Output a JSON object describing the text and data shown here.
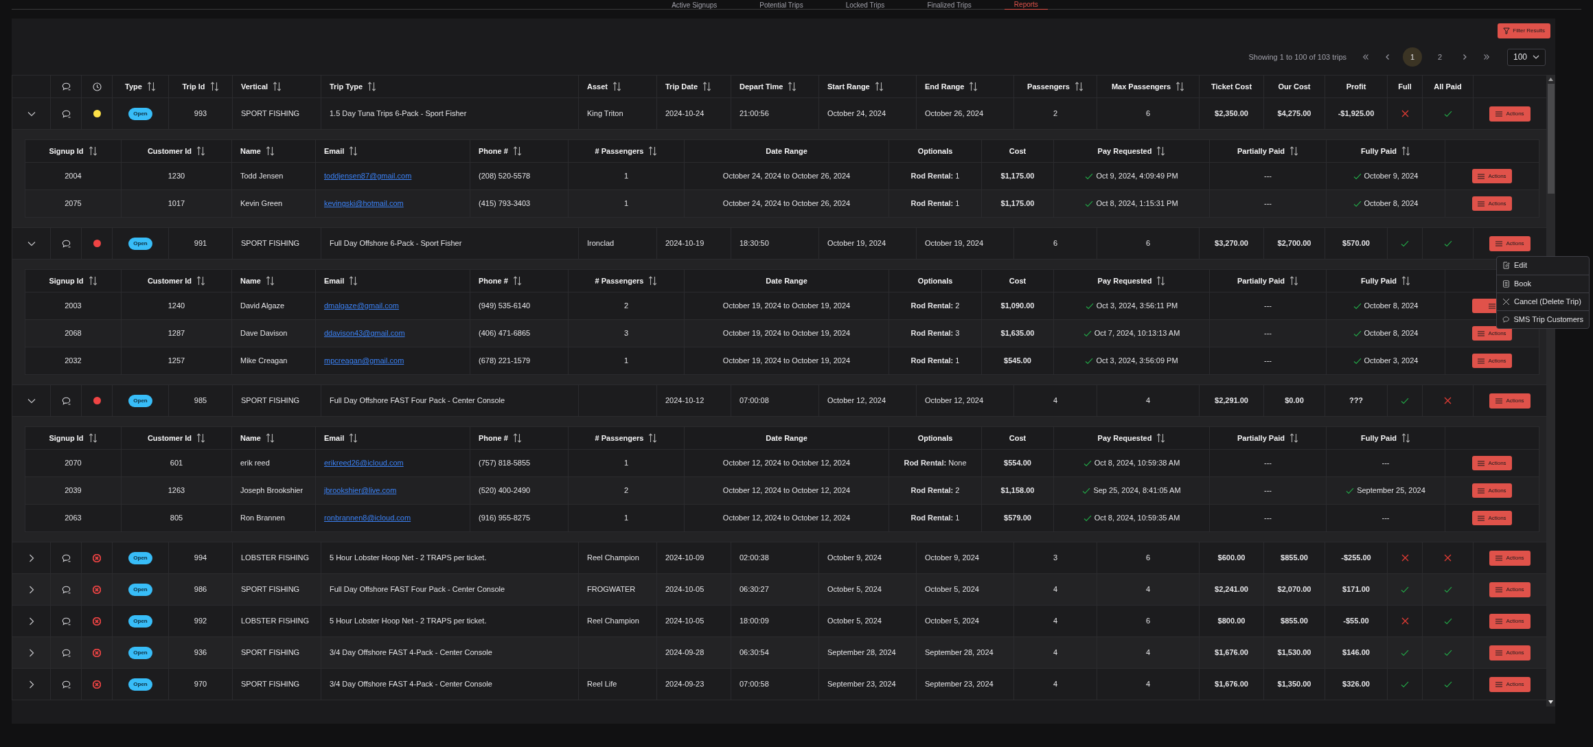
{
  "tabs": [
    {
      "label": "Active Signups",
      "selected": false
    },
    {
      "label": "Potential Trips",
      "selected": false
    },
    {
      "label": "Locked Trips",
      "selected": false
    },
    {
      "label": "Finalized Trips",
      "selected": false
    },
    {
      "label": "Reports",
      "selected": true
    }
  ],
  "filter_button": "Filter Results",
  "pagination": {
    "summary": "Showing 1 to 100 of 103 trips",
    "pages": [
      {
        "label": "1",
        "selected": true
      },
      {
        "label": "2",
        "selected": false
      }
    ],
    "page_size": "100"
  },
  "columns": [
    {
      "label": "Type",
      "sortable": true
    },
    {
      "label": "Trip Id",
      "sortable": true
    },
    {
      "label": "Vertical",
      "sortable": true
    },
    {
      "label": "Trip Type",
      "sortable": true
    },
    {
      "label": "Asset",
      "sortable": true
    },
    {
      "label": "Trip Date",
      "sortable": true
    },
    {
      "label": "Depart Time",
      "sortable": true
    },
    {
      "label": "Start Range",
      "sortable": true
    },
    {
      "label": "End Range",
      "sortable": true
    },
    {
      "label": "Passengers",
      "sortable": true
    },
    {
      "label": "Max Passengers",
      "sortable": true
    },
    {
      "label": "Ticket Cost",
      "sortable": false
    },
    {
      "label": "Our Cost",
      "sortable": false
    },
    {
      "label": "Profit",
      "sortable": false
    },
    {
      "label": "Full",
      "sortable": false
    },
    {
      "label": "All Paid",
      "sortable": false
    }
  ],
  "trips": [
    {
      "expanded": true,
      "status": {
        "kind": "dot",
        "color": "#fde047"
      },
      "type": "Open",
      "trip_id": "993",
      "vertical": "SPORT FISHING",
      "trip_type": "1.5 Day Tuna Trips 6-Pack - Sport Fisher",
      "asset": "King Triton",
      "trip_date": "2024-10-24",
      "depart_time": "21:00:56",
      "start_range": "October 24, 2024",
      "end_range": "October 26, 2024",
      "passengers": "2",
      "max_passengers": "6",
      "ticket_cost": "$2,350.00",
      "our_cost": "$4,275.00",
      "profit": "-$1,925.00",
      "full": false,
      "all_paid": true,
      "action": "Actions",
      "signup_columns": [
        {
          "label": "Signup Id",
          "sortable": true
        },
        {
          "label": "Customer Id",
          "sortable": true
        },
        {
          "label": "Name",
          "sortable": true
        },
        {
          "label": "Email",
          "sortable": true
        },
        {
          "label": "Phone #",
          "sortable": true
        },
        {
          "label": "# Passengers",
          "sortable": true
        },
        {
          "label": "Date Range",
          "sortable": false
        },
        {
          "label": "Optionals",
          "sortable": false
        },
        {
          "label": "Cost",
          "sortable": false
        },
        {
          "label": "Pay Requested",
          "sortable": true
        },
        {
          "label": "Partially Paid",
          "sortable": true
        },
        {
          "label": "Fully Paid",
          "sortable": true
        }
      ],
      "signups": [
        {
          "signup_id": "2004",
          "customer_id": "1230",
          "name": "Todd Jensen",
          "email": "toddjensen87@gmail.com",
          "phone": "(208) 520-5578",
          "passengers": "1",
          "date_range": "October 24, 2024 to October 26, 2024",
          "optionals": "**Rod Rental:** 1",
          "cost": "$1,175.00",
          "pay_requested": {
            "checked": true,
            "text": "Oct 9, 2024, 4:09:49 PM"
          },
          "partially_paid": {
            "checked": false,
            "text": "---"
          },
          "fully_paid": {
            "checked": true,
            "text": "October 9, 2024"
          },
          "action": "Actions"
        },
        {
          "signup_id": "2075",
          "customer_id": "1017",
          "name": "Kevin Green",
          "email": "kevingski@hotmail.com",
          "phone": "(415) 793-3403",
          "passengers": "1",
          "date_range": "October 24, 2024 to October 26, 2024",
          "optionals": "**Rod Rental:** 1",
          "cost": "$1,175.00",
          "pay_requested": {
            "checked": true,
            "text": "Oct 8, 2024, 1:15:31 PM"
          },
          "partially_paid": {
            "checked": false,
            "text": "---"
          },
          "fully_paid": {
            "checked": true,
            "text": "October 8, 2024"
          },
          "action": "Actions"
        }
      ]
    },
    {
      "expanded": true,
      "status": {
        "kind": "dot",
        "color": "#ef4444"
      },
      "type": "Open",
      "trip_id": "991",
      "vertical": "SPORT FISHING",
      "trip_type": "Full Day Offshore 6-Pack - Sport Fisher",
      "asset": "Ironclad",
      "trip_date": "2024-10-19",
      "depart_time": "18:30:50",
      "start_range": "October 19, 2024",
      "end_range": "October 19, 2024",
      "passengers": "6",
      "max_passengers": "6",
      "ticket_cost": "$3,270.00",
      "our_cost": "$2,700.00",
      "profit": "$570.00",
      "full": true,
      "all_paid": true,
      "action": "Actions",
      "menu": [
        {
          "label": "Edit"
        },
        {
          "label": "Book"
        },
        {
          "label": "Cancel (Delete Trip)"
        },
        {
          "label": "SMS Trip Customers"
        }
      ],
      "signup_columns": [
        {
          "label": "Signup Id",
          "sortable": true
        },
        {
          "label": "Customer Id",
          "sortable": true
        },
        {
          "label": "Name",
          "sortable": true
        },
        {
          "label": "Email",
          "sortable": true
        },
        {
          "label": "Phone #",
          "sortable": true
        },
        {
          "label": "# Passengers",
          "sortable": true
        },
        {
          "label": "Date Range",
          "sortable": false
        },
        {
          "label": "Optionals",
          "sortable": false
        },
        {
          "label": "Cost",
          "sortable": false
        },
        {
          "label": "Pay Requested",
          "sortable": true
        },
        {
          "label": "Partially Paid",
          "sortable": true
        },
        {
          "label": "Fully Paid",
          "sortable": true
        }
      ],
      "signups": [
        {
          "signup_id": "2003",
          "customer_id": "1240",
          "name": "David Algaze",
          "email": "dmalgaze@gmail.com",
          "phone": "(949) 535-6140",
          "passengers": "2",
          "date_range": "October 19, 2024 to October 19, 2024",
          "optionals": "**Rod Rental:** 2",
          "cost": "$1,090.00",
          "pay_requested": {
            "checked": true,
            "text": "Oct 3, 2024, 3:56:11 PM"
          },
          "partially_paid": {
            "checked": false,
            "text": "---"
          },
          "fully_paid": {
            "checked": true,
            "text": "October 8, 2024"
          }
        },
        {
          "signup_id": "2068",
          "customer_id": "1287",
          "name": "Dave Davison",
          "email": "ddavison43@gmail.com",
          "phone": "(406) 471-6865",
          "passengers": "3",
          "date_range": "October 19, 2024 to October 19, 2024",
          "optionals": "**Rod Rental:** 3",
          "cost": "$1,635.00",
          "pay_requested": {
            "checked": true,
            "text": "Oct 7, 2024, 10:13:13 AM"
          },
          "partially_paid": {
            "checked": false,
            "text": "---"
          },
          "fully_paid": {
            "checked": true,
            "text": "October 8, 2024"
          },
          "action": "Actions"
        },
        {
          "signup_id": "2032",
          "customer_id": "1257",
          "name": "Mike Creagan",
          "email": "mpcreagan@gmail.com",
          "phone": "(678) 221-1579",
          "passengers": "1",
          "date_range": "October 19, 2024 to October 19, 2024",
          "optionals": "**Rod Rental:** 1",
          "cost": "$545.00",
          "pay_requested": {
            "checked": true,
            "text": "Oct 3, 2024, 3:56:09 PM"
          },
          "partially_paid": {
            "checked": false,
            "text": "---"
          },
          "fully_paid": {
            "checked": true,
            "text": "October 3, 2024"
          },
          "action": "Actions"
        }
      ]
    },
    {
      "expanded": true,
      "status": {
        "kind": "dot",
        "color": "#ef4444"
      },
      "type": "Open",
      "trip_id": "985",
      "vertical": "SPORT FISHING",
      "trip_type": "Full Day Offshore FAST Four Pack - Center Console",
      "trip_date": "2024-10-12",
      "depart_time": "07:00:08",
      "start_range": "October 12, 2024",
      "end_range": "October 12, 2024",
      "passengers": "4",
      "max_passengers": "4",
      "ticket_cost": "$2,291.00",
      "our_cost": "$0.00",
      "profit": "???",
      "full": true,
      "all_paid": false,
      "action": "Actions",
      "signup_columns": [
        {
          "label": "Signup Id",
          "sortable": true
        },
        {
          "label": "Customer Id",
          "sortable": true
        },
        {
          "label": "Name",
          "sortable": true
        },
        {
          "label": "Email",
          "sortable": true
        },
        {
          "label": "Phone #",
          "sortable": true
        },
        {
          "label": "# Passengers",
          "sortable": true
        },
        {
          "label": "Date Range",
          "sortable": false
        },
        {
          "label": "Optionals",
          "sortable": false
        },
        {
          "label": "Cost",
          "sortable": false
        },
        {
          "label": "Pay Requested",
          "sortable": true
        },
        {
          "label": "Partially Paid",
          "sortable": true
        },
        {
          "label": "Fully Paid",
          "sortable": true
        }
      ],
      "signups": [
        {
          "signup_id": "2070",
          "customer_id": "601",
          "name": "erik reed",
          "email": "erikreed26@icloud.com",
          "phone": "(757) 818-5855",
          "passengers": "1",
          "date_range": "October 12, 2024 to October 12, 2024",
          "optionals": "**Rod Rental:** None",
          "cost": "$554.00",
          "pay_requested": {
            "checked": true,
            "text": "Oct 8, 2024, 10:59:38 AM"
          },
          "partially_paid": {
            "checked": false,
            "text": "---"
          },
          "fully_paid": {
            "checked": false,
            "text": "---"
          },
          "action": "Actions"
        },
        {
          "signup_id": "2039",
          "customer_id": "1263",
          "name": "Joseph Brookshier",
          "email": "jbrookshier@live.com",
          "phone": "(520) 400-2490",
          "passengers": "2",
          "date_range": "October 12, 2024 to October 12, 2024",
          "optionals": "**Rod Rental:** 2",
          "cost": "$1,158.00",
          "pay_requested": {
            "checked": true,
            "text": "Sep 25, 2024, 8:41:05 AM"
          },
          "partially_paid": {
            "checked": false,
            "text": "---"
          },
          "fully_paid": {
            "checked": true,
            "text": "September 25, 2024"
          },
          "action": "Actions"
        },
        {
          "signup_id": "2063",
          "customer_id": "805",
          "name": "Ron Brannen",
          "email": "ronbrannen8@icloud.com",
          "phone": "(916) 955-8275",
          "passengers": "1",
          "date_range": "October 12, 2024 to October 12, 2024",
          "optionals": "**Rod Rental:** 1",
          "cost": "$579.00",
          "pay_requested": {
            "checked": true,
            "text": "Oct 8, 2024, 10:59:35 AM"
          },
          "partially_paid": {
            "checked": false,
            "text": "---"
          },
          "fully_paid": {
            "checked": false,
            "text": "---"
          },
          "action": "Actions"
        }
      ]
    },
    {
      "expanded": false,
      "status": {
        "kind": "x-circle",
        "color": "#ef4444"
      },
      "type": "Open",
      "trip_id": "994",
      "vertical": "LOBSTER FISHING",
      "trip_type": "5 Hour Lobster Hoop Net - 2 TRAPS per ticket.",
      "asset": "Reel Champion",
      "trip_date": "2024-10-09",
      "depart_time": "02:00:38",
      "start_range": "October 9, 2024",
      "end_range": "October 9, 2024",
      "passengers": "3",
      "max_passengers": "6",
      "ticket_cost": "$600.00",
      "our_cost": "$855.00",
      "profit": "-$255.00",
      "full": false,
      "all_paid": false,
      "action": "Actions"
    },
    {
      "expanded": false,
      "status": {
        "kind": "x-circle",
        "color": "#ef4444"
      },
      "type": "Open",
      "trip_id": "986",
      "vertical": "SPORT FISHING",
      "trip_type": "Full Day Offshore FAST Four Pack - Center Console",
      "asset": "FROGWATER",
      "trip_date": "2024-10-05",
      "depart_time": "06:30:27",
      "start_range": "October 5, 2024",
      "end_range": "October 5, 2024",
      "passengers": "4",
      "max_passengers": "4",
      "ticket_cost": "$2,241.00",
      "our_cost": "$2,070.00",
      "profit": "$171.00",
      "full": true,
      "all_paid": true,
      "action": "Actions"
    },
    {
      "expanded": false,
      "status": {
        "kind": "x-circle",
        "color": "#ef4444"
      },
      "type": "Open",
      "trip_id": "992",
      "vertical": "LOBSTER FISHING",
      "trip_type": "5 Hour Lobster Hoop Net - 2 TRAPS per ticket.",
      "asset": "Reel Champion",
      "trip_date": "2024-10-05",
      "depart_time": "18:00:09",
      "start_range": "October 5, 2024",
      "end_range": "October 5, 2024",
      "passengers": "4",
      "max_passengers": "6",
      "ticket_cost": "$800.00",
      "our_cost": "$855.00",
      "profit": "-$55.00",
      "full": false,
      "all_paid": true,
      "action": "Actions"
    },
    {
      "expanded": false,
      "status": {
        "kind": "x-circle",
        "color": "#ef4444"
      },
      "type": "Open",
      "trip_id": "936",
      "vertical": "SPORT FISHING",
      "trip_type": "3/4 Day Offshore FAST 4-Pack - Center Console",
      "trip_date": "2024-09-28",
      "depart_time": "06:30:54",
      "start_range": "September 28, 2024",
      "end_range": "September 28, 2024",
      "passengers": "4",
      "max_passengers": "4",
      "ticket_cost": "$1,676.00",
      "our_cost": "$1,530.00",
      "profit": "$146.00",
      "full": true,
      "all_paid": true,
      "action": "Actions"
    },
    {
      "expanded": false,
      "status": {
        "kind": "x-circle",
        "color": "#ef4444"
      },
      "type": "Open",
      "trip_id": "970",
      "vertical": "SPORT FISHING",
      "trip_type": "3/4 Day Offshore FAST 4-Pack - Center Console",
      "asset": "Reel Life",
      "trip_date": "2024-09-23",
      "depart_time": "07:00:58",
      "start_range": "September 23, 2024",
      "end_range": "September 23, 2024",
      "passengers": "4",
      "max_passengers": "4",
      "ticket_cost": "$1,676.00",
      "our_cost": "$1,350.00",
      "profit": "$326.00",
      "full": true,
      "all_paid": true,
      "action": "Actions"
    }
  ]
}
